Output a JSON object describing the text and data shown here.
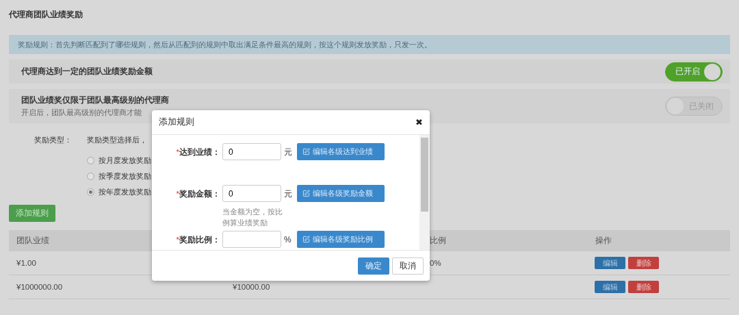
{
  "page_title": "代理商团队业绩奖励",
  "notice": "奖励规则：首先判断匹配到了哪些规则，然后从匹配到的规则中取出满足条件最高的规则，按这个规则发放奖励，只发一次。",
  "settings": [
    {
      "title": "代理商达到一定的团队业绩奖励金额",
      "switch": {
        "label": "已开启",
        "on": true
      }
    },
    {
      "title": "团队业绩奖仅限于团队最高级别的代理商",
      "description": "开启后，团队最高级别的代理商才能",
      "switch": {
        "label": "已关闭",
        "on": false
      }
    }
  ],
  "reward_type": {
    "label": "奖励类型：",
    "hint": "奖励类型选择后，",
    "options": [
      {
        "label": "按月度发放奖励",
        "selected": false
      },
      {
        "label": "按季度发放奖励",
        "selected": false
      },
      {
        "label": "按年度发放奖励",
        "selected": true
      }
    ]
  },
  "add_button": "添加规则",
  "table": {
    "header": {
      "column_1": "团队业绩",
      "column_3": "比例",
      "column_4": "操作"
    },
    "rows": [
      {
        "column_1": "¥1.00",
        "column_3": "0%",
        "actions": [
          {
            "label": "编辑",
            "kind": "edit"
          },
          {
            "label": "删除",
            "kind": "delete"
          }
        ]
      },
      {
        "column_1": "¥1000000.00",
        "column_2": "¥10000.00",
        "actions": [
          {
            "label": "编辑",
            "kind": "edit"
          },
          {
            "label": "删除",
            "kind": "delete"
          }
        ]
      }
    ]
  },
  "dialog": {
    "title": "添加规则",
    "close": "✖",
    "fields": [
      {
        "required_mark": "*",
        "label": "达到业绩：",
        "value": "0",
        "unit": "元",
        "button": "编辑各级达到业绩"
      },
      {
        "required_mark": "*",
        "label": "奖励金额：",
        "value": "0",
        "unit": "元",
        "button": "编辑各级奖励金额",
        "hint": "当金额为空，按比例算业绩奖励"
      },
      {
        "required_mark": "*",
        "label": "奖励比例：",
        "unit": "%",
        "button": "编辑各级奖励比例"
      }
    ],
    "buttons": [
      {
        "label": "确定",
        "kind": "primary"
      },
      {
        "label": "取消",
        "kind": "default"
      }
    ]
  }
}
